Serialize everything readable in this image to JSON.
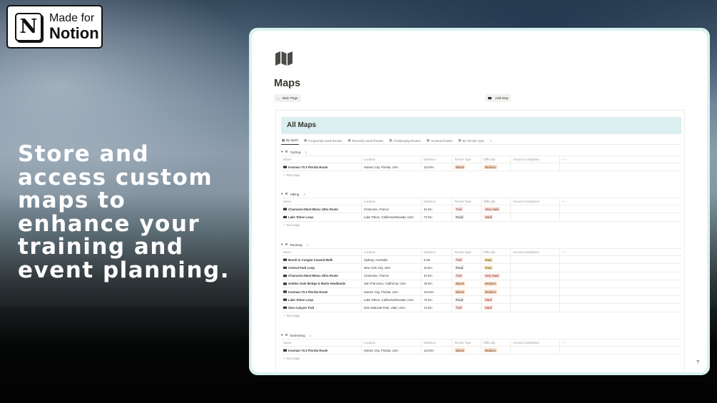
{
  "badge": {
    "line1": "Made for",
    "line2": "Notion",
    "logo_letter": "N"
  },
  "headline": "Store and access custom maps to enhance your training and event planning.",
  "page": {
    "icon": "map-icon",
    "title": "Maps",
    "main_page_button": "Main Page",
    "add_map_button": "Add Map",
    "db_title": "All Maps",
    "help_label": "?"
  },
  "tabs": [
    {
      "label": "By Sport",
      "icon": "table-icon"
    },
    {
      "label": "Frequently Used Routes",
      "icon": "refresh-icon"
    },
    {
      "label": "Recently Used Routes",
      "icon": "history-icon"
    },
    {
      "label": "Challenging Routes",
      "icon": "alert-icon"
    },
    {
      "label": "Unused Routes",
      "icon": "circle-icon"
    },
    {
      "label": "By Terrain Type",
      "icon": "mountain-icon"
    }
  ],
  "columns": {
    "name": "Name",
    "location": "Location",
    "distance": "Distance",
    "terrain": "Terrain Type",
    "difficulty": "Difficulty",
    "amount": "Amount Completed"
  },
  "new_page_label": "New page",
  "tag_colors": {
    "Mixed": {
      "bg": "#fadec9",
      "fg": "#5c3b23"
    },
    "Trail": {
      "bg": "#fbe4e4",
      "fg": "#6e3630"
    },
    "Road": {
      "bg": "#f1f1ef",
      "fg": "#37352f"
    },
    "Medium": {
      "bg": "#fadec9",
      "fg": "#5c3b23"
    },
    "Very Hard": {
      "bg": "#ffe2dd",
      "fg": "#5d1715"
    },
    "Hard": {
      "bg": "#ffe2dd",
      "fg": "#5d1715"
    },
    "Easy": {
      "bg": "#fdecc8",
      "fg": "#402c1b"
    }
  },
  "groups": [
    {
      "name": "Cycling",
      "count": "1",
      "icon": "cyclist-icon",
      "rows": [
        {
          "name": "Ironman 70.3 Florida Route",
          "location": "Haines City, Florida, USA",
          "distance": "113 km",
          "terrain": "Mixed",
          "difficulty": "Medium"
        }
      ]
    },
    {
      "name": "Hiking",
      "count": "2",
      "icon": "hiking-icon",
      "rows": [
        {
          "name": "Chamonix-Mont-Blanc Ultra Route",
          "location": "Chamonix, France",
          "distance": "42 km",
          "terrain": "Trail",
          "difficulty": "Very Hard"
        },
        {
          "name": "Lake Tahoe Loop",
          "location": "Lake Tahoe, California/Nevada, USA",
          "distance": "72 km",
          "terrain": "Road",
          "difficulty": "Hard"
        }
      ]
    },
    {
      "name": "Running",
      "count": "7",
      "icon": "running-icon",
      "rows": [
        {
          "name": "Bondi to Coogee Coastal Walk",
          "location": "Sydney, Australia",
          "distance": "6 km",
          "terrain": "Trail",
          "difficulty": "Easy"
        },
        {
          "name": "Central Park Loop",
          "location": "New York City, USA",
          "distance": "10 km",
          "terrain": "Road",
          "difficulty": "Easy"
        },
        {
          "name": "Chamonix-Mont-Blanc Ultra Route",
          "location": "Chamonix, France",
          "distance": "42 km",
          "terrain": "Trail",
          "difficulty": "Very Hard"
        },
        {
          "name": "Golden Gate Bridge & Marin Headlands",
          "location": "San Francisco, California, USA",
          "distance": "15 km",
          "terrain": "Mixed",
          "difficulty": "Medium"
        },
        {
          "name": "Ironman 70.3 Florida Route",
          "location": "Haines City, Florida, USA",
          "distance": "113 km",
          "terrain": "Mixed",
          "difficulty": "Medium"
        },
        {
          "name": "Lake Tahoe Loop",
          "location": "Lake Tahoe, California/Nevada, USA",
          "distance": "72 km",
          "terrain": "Road",
          "difficulty": "Hard"
        },
        {
          "name": "Zion Canyon Trail",
          "location": "Zion National Park, Utah, USA",
          "distance": "12 km",
          "terrain": "Trail",
          "difficulty": "Hard"
        }
      ]
    },
    {
      "name": "Swimming",
      "count": "1",
      "icon": "swimming-icon",
      "rows": [
        {
          "name": "Ironman 70.3 Florida Route",
          "location": "Haines City, Florida, USA",
          "distance": "113 km",
          "terrain": "Mixed",
          "difficulty": "Medium"
        }
      ]
    }
  ]
}
